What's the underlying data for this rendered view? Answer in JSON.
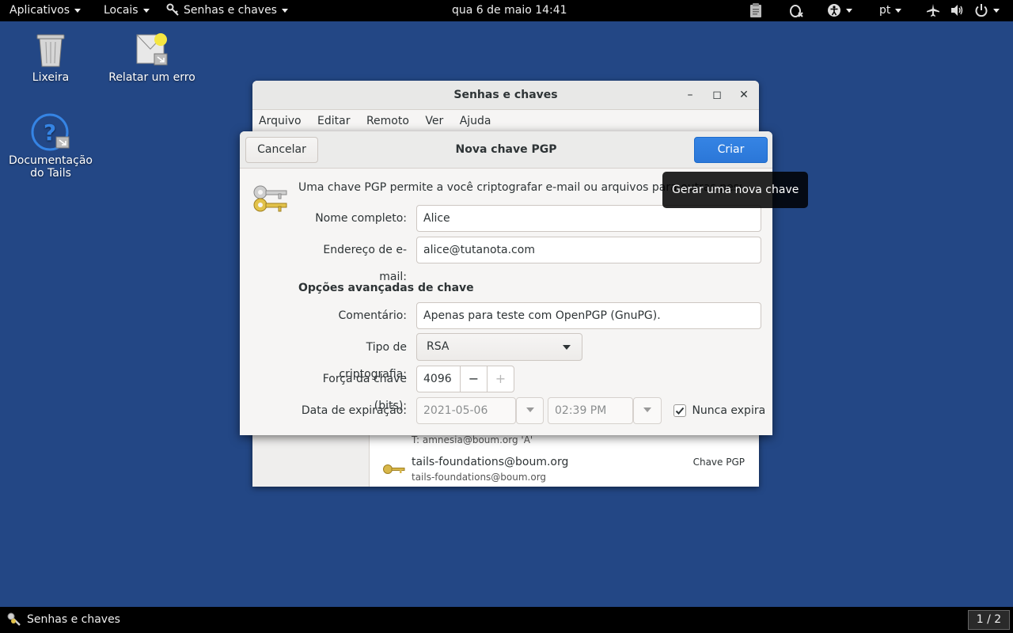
{
  "topbar": {
    "apps_label": "Aplicativos",
    "places_label": "Locais",
    "app_menu_label": "Senhas e chaves",
    "clock": "qua 6 de maio  14:41",
    "lang": "pt"
  },
  "desktop": {
    "trash_label": "Lixeira",
    "report_label": "Relatar um erro",
    "docs_label_1": "Documentação",
    "docs_label_2": "do Tails"
  },
  "bg_window": {
    "title": "Senhas e chaves",
    "menu": [
      "Arquivo",
      "Editar",
      "Remoto",
      "Ver",
      "Ajuda"
    ],
    "partial_row": "T: amnesia@boum.org 'A'",
    "key_row": {
      "name": "tails-foundations@boum.org",
      "email": "tails-foundations@boum.org",
      "type": "Chave PGP"
    }
  },
  "dialog": {
    "title": "Nova chave PGP",
    "cancel_label": "Cancelar",
    "create_label": "Criar",
    "intro": "Uma chave PGP permite a você criptografar e-mail ou arquivos para outras pessoas.",
    "name_label": "Nome completo:",
    "name_value": "Alice",
    "email_label": "Endereço de e-mail:",
    "email_value": "alice@tutanota.com",
    "advanced_heading": "Opções avançadas de chave",
    "comment_label": "Comentário:",
    "comment_value": "Apenas para teste com OpenPGP (GnuPG).",
    "type_label": "Tipo de criptografia:",
    "type_value": "RSA",
    "strength_label": "Força da chave (bits):",
    "strength_value": "4096",
    "expiry_label": "Data de expiração:",
    "expiry_date": "2021-05-06",
    "expiry_time": "02:39 PM",
    "never_expires_label": "Nunca expira",
    "never_expires_checked": true
  },
  "tooltip": {
    "text": "Gerar uma nova chave"
  },
  "taskbar": {
    "window_label": "Senhas e chaves",
    "workspace": "1 / 2"
  },
  "colors": {
    "desktop_bg": "#234785",
    "accent": "#3584e4"
  }
}
